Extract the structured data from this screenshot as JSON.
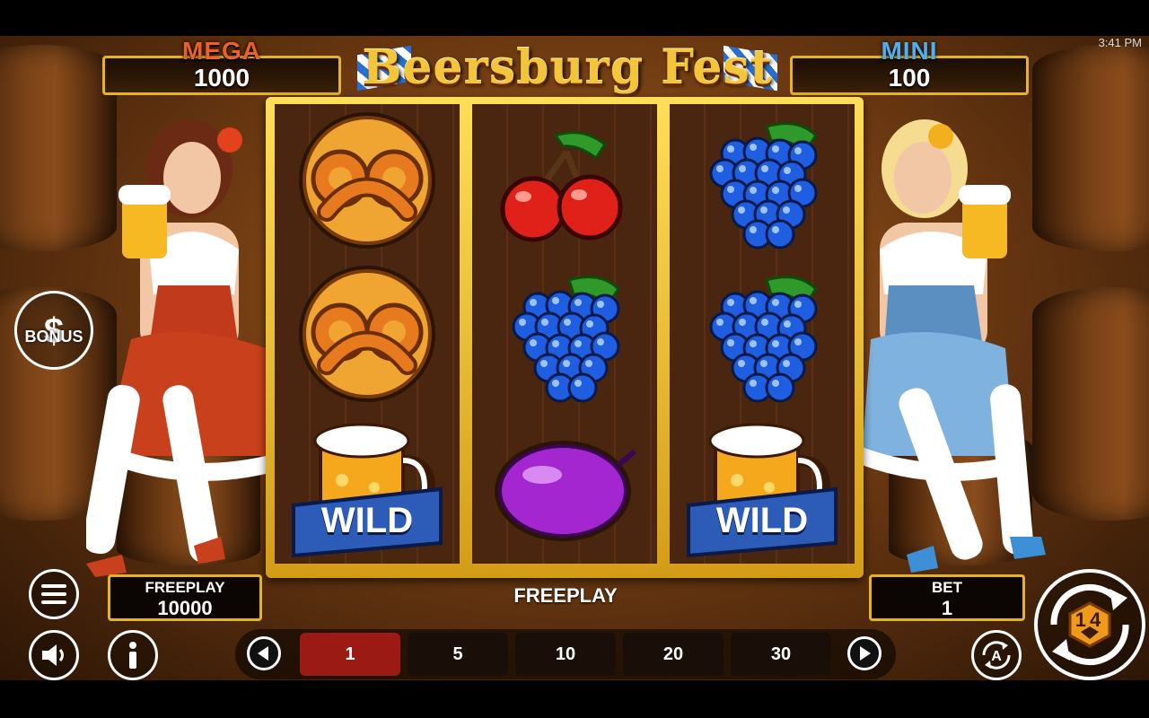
{
  "status_bar": {
    "time": "3:41 PM"
  },
  "game": {
    "title": "Beersburg Fest"
  },
  "jackpots": {
    "mega": {
      "label": "MEGA",
      "value": "1000",
      "color": "#e8622a"
    },
    "mini": {
      "label": "MINI",
      "value": "100",
      "color": "#4fb0f0"
    }
  },
  "bonus_button": {
    "label": "BONUS"
  },
  "reels": [
    [
      "pretzel",
      "pretzel",
      "wild"
    ],
    [
      "cherries",
      "grapes",
      "plum"
    ],
    [
      "grapes",
      "grapes",
      "wild"
    ]
  ],
  "wild_label": "WILD",
  "feature_label": "FREEPLAY",
  "balance": {
    "label": "FREEPLAY",
    "value": "10000"
  },
  "bet": {
    "label": "BET",
    "value": "1"
  },
  "bet_options": [
    "1",
    "5",
    "10",
    "20",
    "30"
  ],
  "selected_bet": "1",
  "spin_button": {
    "label": "14"
  },
  "colors": {
    "gold": "#e6b422",
    "selected_bet": "#9b1a14",
    "reel_bg": "#4a2510"
  }
}
